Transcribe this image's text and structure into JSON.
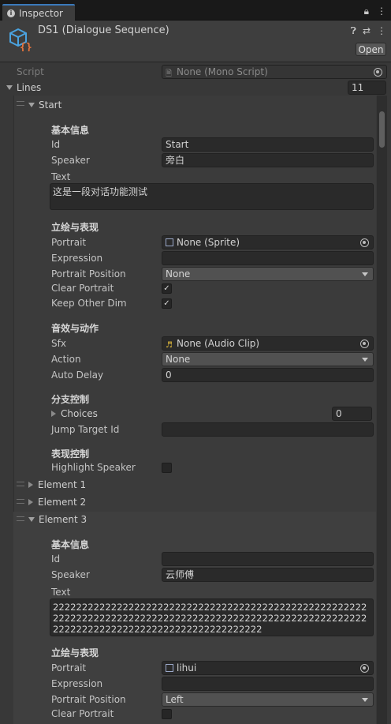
{
  "tab": {
    "title": "Inspector",
    "lock_icon": "lock-icon",
    "menu_icon": "kebab-menu-icon"
  },
  "header": {
    "title": "DS1 (Dialogue Sequence)",
    "open_label": "Open",
    "help_icon": "help-icon",
    "presets_icon": "presets-icon",
    "context_icon": "kebab-menu-icon"
  },
  "script": {
    "label": "Script",
    "value": "None (Mono Script)"
  },
  "lines": {
    "label": "Lines",
    "count": "11"
  },
  "element0": {
    "title": "Start",
    "basic": {
      "section": "基本信息",
      "id_label": "Id",
      "id_value": "Start",
      "speaker_label": "Speaker",
      "speaker_value": "旁白",
      "text_label": "Text",
      "text_value": "这是一段对话功能测试"
    },
    "visual": {
      "section": "立绘与表现",
      "portrait_label": "Portrait",
      "portrait_value": "None (Sprite)",
      "expression_label": "Expression",
      "expression_value": "",
      "position_label": "Portrait Position",
      "position_value": "None",
      "clear_label": "Clear Portrait",
      "clear_checked": true,
      "keepdim_label": "Keep Other Dim",
      "keepdim_checked": true
    },
    "audio": {
      "section": "音效与动作",
      "sfx_label": "Sfx",
      "sfx_value": "None (Audio Clip)",
      "action_label": "Action",
      "action_value": "None",
      "delay_label": "Auto Delay",
      "delay_value": "0"
    },
    "branch": {
      "section": "分支控制",
      "choices_label": "Choices",
      "choices_value": "0",
      "jump_label": "Jump Target Id",
      "jump_value": ""
    },
    "show": {
      "section": "表现控制",
      "highlight_label": "Highlight Speaker",
      "highlight_checked": false
    }
  },
  "element1": {
    "title": "Element 1"
  },
  "element2": {
    "title": "Element 2"
  },
  "element3": {
    "title": "Element 3",
    "basic": {
      "section": "基本信息",
      "id_label": "Id",
      "id_value": "",
      "speaker_label": "Speaker",
      "speaker_value": "云师傅",
      "text_label": "Text",
      "text_value": "222222222222222222222222222222222222222222222222222222222222222222222222222222222222222222222222222222222222222222222222222222222222222222222222"
    },
    "visual": {
      "section": "立绘与表现",
      "portrait_label": "Portrait",
      "portrait_value": "lihui",
      "expression_label": "Expression",
      "expression_value": "",
      "position_label": "Portrait Position",
      "position_value": "Left",
      "clear_label": "Clear Portrait",
      "clear_checked": false
    }
  },
  "colors": {
    "accent": "#3a79bb",
    "panel": "#383838",
    "field": "#2a2a2a"
  }
}
